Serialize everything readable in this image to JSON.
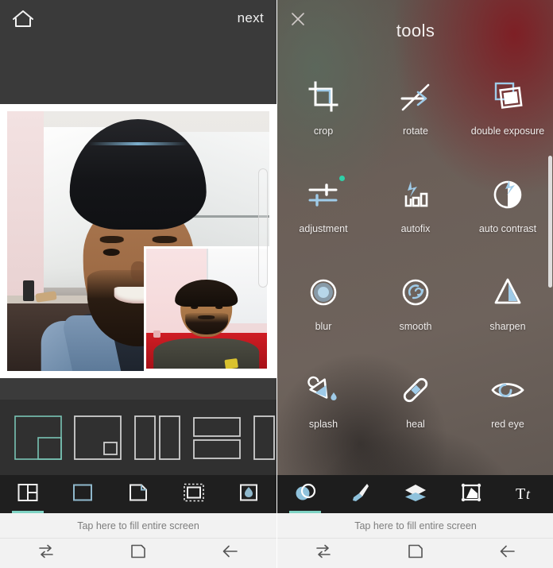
{
  "left_panel": {
    "header": {
      "home_icon": "home-icon",
      "next_label": "next"
    },
    "canvas": {
      "alt_main": "selfie-photo-man-in-black-beanie",
      "alt_pip": "inset-photo-man-in-olive-sweatshirt",
      "scroll_hint": "canvas-scroll-indicator"
    },
    "layout_strip": {
      "items": [
        {
          "name": "layout-pip-bottom-right",
          "selected": true
        },
        {
          "name": "layout-small-inset-square",
          "selected": false
        },
        {
          "name": "layout-two-columns",
          "selected": false
        },
        {
          "name": "layout-two-rows",
          "selected": false
        },
        {
          "name": "layout-partial-column",
          "selected": false
        }
      ]
    },
    "toolbar": {
      "items": [
        {
          "name": "layouts",
          "icon": "grid-layout-icon",
          "selected": true
        },
        {
          "name": "border",
          "icon": "square-border-icon",
          "selected": false
        },
        {
          "name": "page-curl",
          "icon": "page-curl-icon",
          "selected": false
        },
        {
          "name": "dashed-border",
          "icon": "dashed-square-icon",
          "selected": false
        },
        {
          "name": "fill",
          "icon": "water-drop-frame-icon",
          "selected": false
        }
      ]
    },
    "caption": "Tap here to fill entire screen",
    "navbar": {
      "recent": "recents-icon",
      "home": "home-square-icon",
      "back": "back-arrow-icon"
    }
  },
  "right_panel": {
    "header": {
      "close_icon": "close-icon",
      "title": "tools"
    },
    "tools": [
      {
        "label": "crop",
        "icon": "crop-icon",
        "badge": false
      },
      {
        "label": "rotate",
        "icon": "rotate-icon",
        "badge": false
      },
      {
        "label": "double exposure",
        "icon": "double-exposure-icon",
        "badge": false
      },
      {
        "label": "adjustment",
        "icon": "adjustment-sliders-icon",
        "badge": true
      },
      {
        "label": "autofix",
        "icon": "autofix-icon",
        "badge": false
      },
      {
        "label": "auto contrast",
        "icon": "auto-contrast-icon",
        "badge": false
      },
      {
        "label": "blur",
        "icon": "blur-icon",
        "badge": false
      },
      {
        "label": "smooth",
        "icon": "smooth-icon",
        "badge": false
      },
      {
        "label": "sharpen",
        "icon": "sharpen-icon",
        "badge": false
      },
      {
        "label": "splash",
        "icon": "splash-paint-bucket-icon",
        "badge": false
      },
      {
        "label": "heal",
        "icon": "heal-bandage-icon",
        "badge": false
      },
      {
        "label": "red eye",
        "icon": "red-eye-icon",
        "badge": false
      }
    ],
    "toolbar": {
      "items": [
        {
          "name": "tools",
          "icon": "tools-circle-icon",
          "selected": true
        },
        {
          "name": "brush",
          "icon": "paint-brush-icon",
          "selected": false
        },
        {
          "name": "layers",
          "icon": "layers-icon",
          "selected": false
        },
        {
          "name": "frames",
          "icon": "frame-icon",
          "selected": false
        },
        {
          "name": "text",
          "icon": "text-tool-icon",
          "selected": false
        }
      ]
    },
    "caption": "Tap here to fill entire screen",
    "navbar": {
      "recent": "recents-icon",
      "home": "home-square-icon",
      "back": "back-arrow-icon"
    }
  },
  "colors": {
    "accent_teal": "#7fd3c4",
    "icon_blue": "#9fcbe8",
    "badge_green": "#2fd0a8",
    "toolbar_dark": "#1f1f1f",
    "header_gray": "#3a3a3a",
    "caption_bg": "#f2f2f2"
  }
}
